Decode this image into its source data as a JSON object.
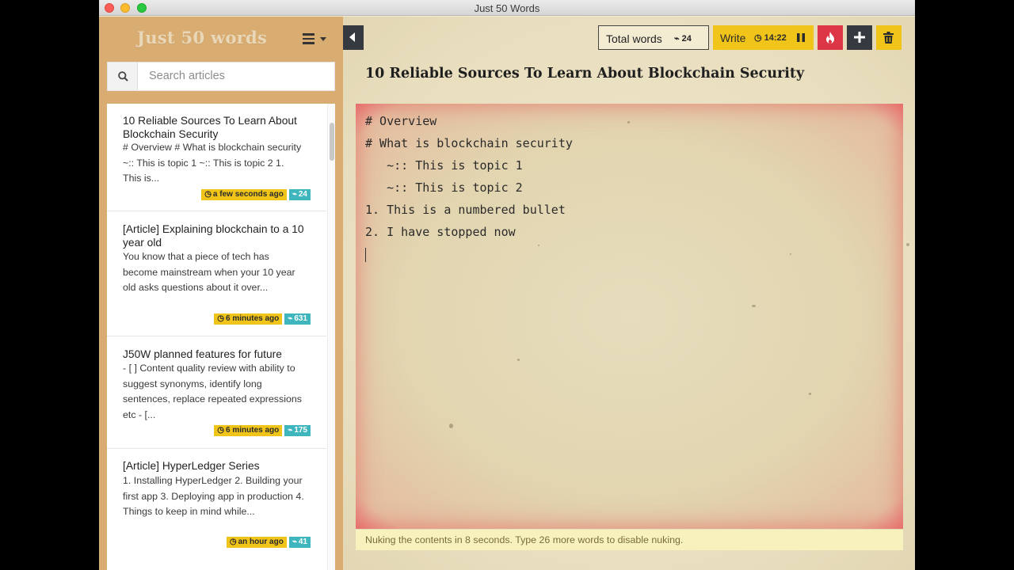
{
  "window": {
    "title": "Just 50 Words"
  },
  "sidebar": {
    "brand": "Just 50 words",
    "search": {
      "placeholder": "Search articles",
      "value": ""
    },
    "articles": [
      {
        "title": "10 Reliable Sources To Learn About Blockchain Security",
        "excerpt": "# Overview # What is blockchain security ~:: This is topic 1 ~:: This is topic 2 1. This is...",
        "time": "a few seconds ago",
        "words": "24"
      },
      {
        "title": "[Article] Explaining blockchain to a 10 year old",
        "excerpt": "You know that a piece of tech has become mainstream when your 10 year old asks questions about it over...",
        "time": "6 minutes ago",
        "words": "631"
      },
      {
        "title": "J50W planned features for future",
        "excerpt": "- [ ] Content quality review with ability to suggest synonyms, identify long sentences, replace repeated expressions etc - [...",
        "time": "6 minutes ago",
        "words": "175"
      },
      {
        "title": "[Article] HyperLedger Series",
        "excerpt": "1. Installing HyperLedger 2. Building your first app 3. Deploying app in production 4. Things to keep in mind while...",
        "time": "an hour ago",
        "words": "41"
      }
    ]
  },
  "toolbar": {
    "total_words_label": "Total words",
    "total_words_count": "24",
    "write_label": "Write",
    "timer": "14:22"
  },
  "document": {
    "title": "10 Reliable Sources To Learn About Blockchain Security",
    "lines": [
      "# Overview",
      "# What is blockchain security",
      "   ~:: This is topic 1",
      "   ~:: This is topic 2",
      "1. This is a numbered bullet",
      "2. I have stopped now"
    ]
  },
  "status": {
    "message": "Nuking the contents in 8 seconds. Type 26 more words to disable nuking."
  },
  "colors": {
    "accent": "#f0c419",
    "danger": "#dc3545",
    "dark": "#343a40",
    "teal": "#3fb6bd",
    "sidebar": "#d9ad72"
  }
}
